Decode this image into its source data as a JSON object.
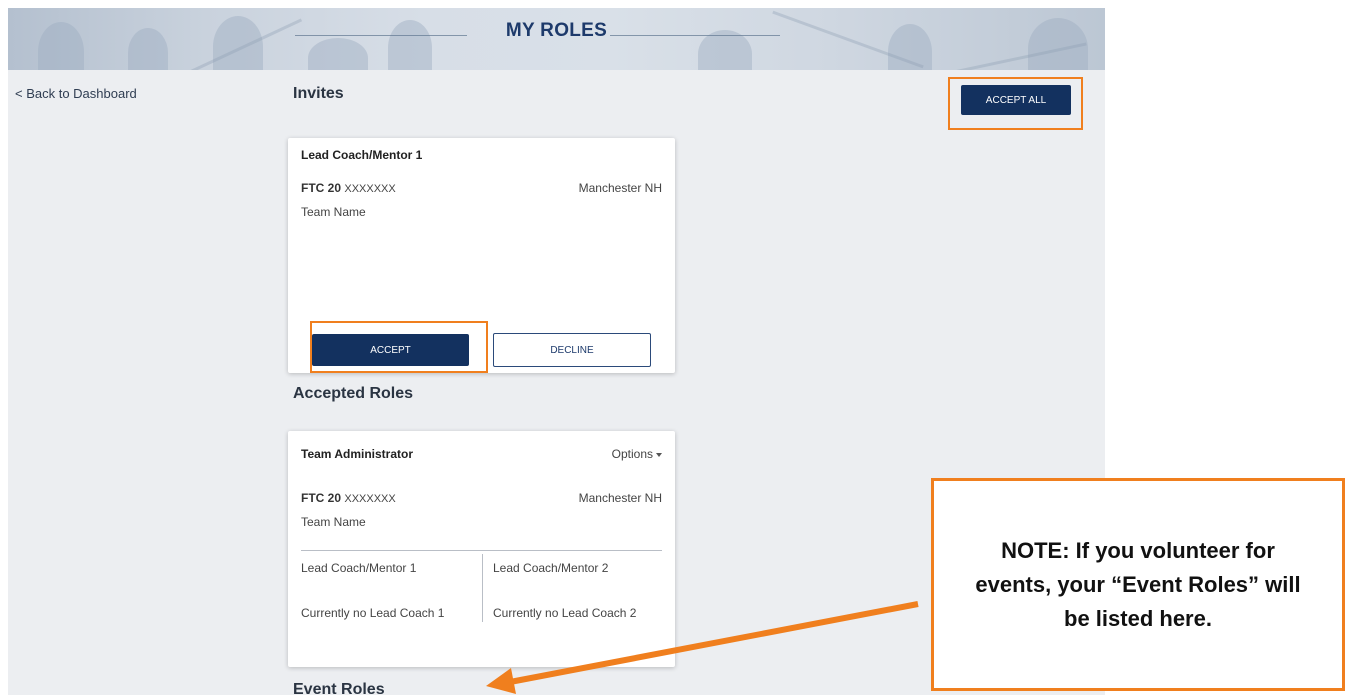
{
  "header": {
    "title": "MY ROLES"
  },
  "nav": {
    "back_label": "< Back to Dashboard"
  },
  "invites": {
    "heading": "Invites",
    "accept_all_label": "ACCEPT ALL",
    "card": {
      "role": "Lead Coach/Mentor 1",
      "program_bold": "FTC 20",
      "program_id": "XXXXXXX",
      "location": "Manchester NH",
      "team_name": "Team Name",
      "accept_label": "ACCEPT",
      "decline_label": "DECLINE"
    }
  },
  "accepted_roles": {
    "heading": "Accepted Roles",
    "card": {
      "role": "Team Administrator",
      "options_label": "Options",
      "program_bold": "FTC 20",
      "program_id": "XXXXXXX",
      "location": "Manchester NH",
      "team_name": "Team Name",
      "coach1_label": "Lead Coach/Mentor 1",
      "coach2_label": "Lead Coach/Mentor 2",
      "coach1_status": "Currently no Lead Coach 1",
      "coach2_status": "Currently no Lead Coach 2"
    }
  },
  "event_roles": {
    "heading": "Event Roles"
  },
  "annotation": {
    "note": "NOTE: If you volunteer for events, your “Event Roles” will be listed here.",
    "color": "#f07f1e"
  },
  "colors": {
    "primary": "#13315f",
    "page_bg": "#eceef1",
    "highlight": "#f07f1e"
  }
}
